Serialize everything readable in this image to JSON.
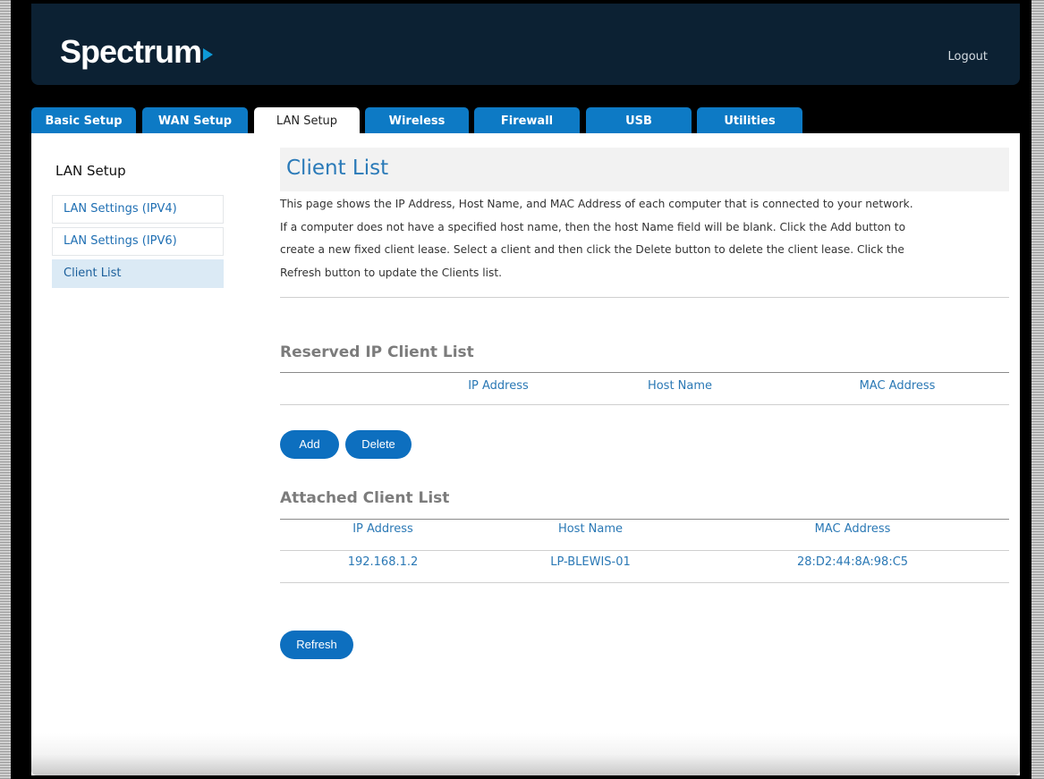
{
  "header": {
    "logo_text": "Spectrum",
    "logout_label": "Logout"
  },
  "tabs": [
    {
      "label": "Basic Setup"
    },
    {
      "label": "WAN Setup"
    },
    {
      "label": "LAN Setup",
      "active": true
    },
    {
      "label": "Wireless"
    },
    {
      "label": "Firewall"
    },
    {
      "label": "USB"
    },
    {
      "label": "Utilities"
    }
  ],
  "sidebar": {
    "title": "LAN Setup",
    "items": [
      {
        "label": "LAN Settings (IPV4)"
      },
      {
        "label": "LAN Settings (IPV6)"
      },
      {
        "label": "Client List",
        "active": true
      }
    ]
  },
  "main": {
    "title": "Client List",
    "description_lines": [
      "This page shows the IP Address, Host Name, and MAC Address of each computer that is connected to your network.",
      "If a computer does not have a specified host name, then the host Name field will be blank. Click the Add button to",
      "create a new fixed client lease. Select a client and then click the Delete button to delete the client lease. Click the",
      "Refresh button to update the Clients list."
    ],
    "reserved": {
      "title": "Reserved IP Client List",
      "columns": [
        "IP Address",
        "Host Name",
        "MAC Address"
      ],
      "add_label": "Add",
      "delete_label": "Delete"
    },
    "attached": {
      "title": "Attached Client List",
      "columns": [
        "IP Address",
        "Host Name",
        "MAC Address"
      ],
      "rows": [
        [
          "192.168.1.2",
          "LP-BLEWIS-01",
          "28:D2:44:8A:98:C5"
        ]
      ]
    },
    "refresh_label": "Refresh"
  },
  "colors": {
    "header_bg": "#0c2133",
    "tab_bg": "#0d7ac5",
    "button_bg": "#0d6fbf",
    "link_blue": "#2a78b5",
    "logo_accent": "#0e9ad7"
  }
}
